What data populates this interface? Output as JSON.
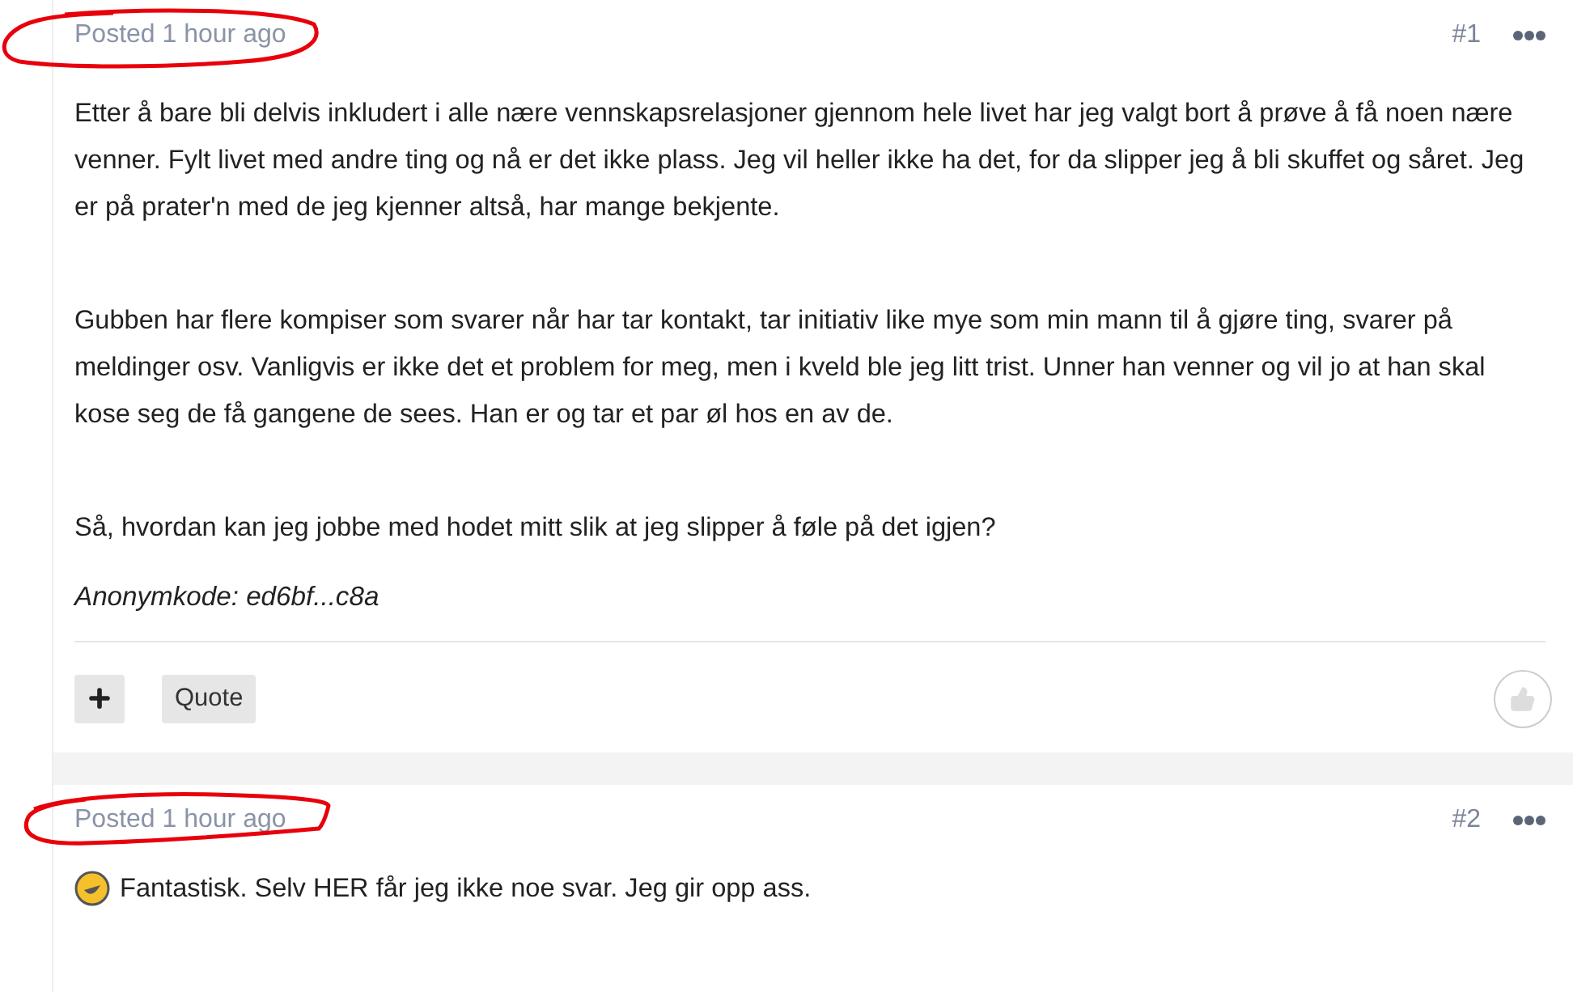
{
  "posts": [
    {
      "posted": "Posted 1 hour ago",
      "number": "#1",
      "has_emoji": false,
      "paragraphs": [
        "Etter å bare bli delvis inkludert i alle nære vennskapsrelasjoner gjennom hele livet har jeg valgt bort å prøve å få noen nære venner. Fylt livet med andre ting og nå er det ikke plass. Jeg vil heller ikke ha det, for da slipper jeg å bli skuffet og såret. Jeg er på prater'n med de jeg kjenner altså, har mange bekjente.",
        "Gubben har flere kompiser som svarer når har tar kontakt, tar initiativ like mye som min mann til å gjøre ting, svarer på meldinger osv. Vanligvis er ikke det et problem for meg, men i kveld ble jeg litt trist. Unner han venner og vil jo at han skal kose seg de få gangene de sees. Han er og tar et par øl hos en av de.",
        "Så, hvordan kan jeg jobbe med hodet mitt slik at jeg slipper å føle på det igjen?"
      ],
      "signature": "Anonymkode: ed6bf...c8a",
      "quote_button": "Quote"
    },
    {
      "posted": "Posted 1 hour ago",
      "number": "#2",
      "has_emoji": true,
      "paragraphs": [
        "Fantastisk. Selv HER får jeg ikke noe svar. Jeg gir opp ass."
      ]
    }
  ]
}
